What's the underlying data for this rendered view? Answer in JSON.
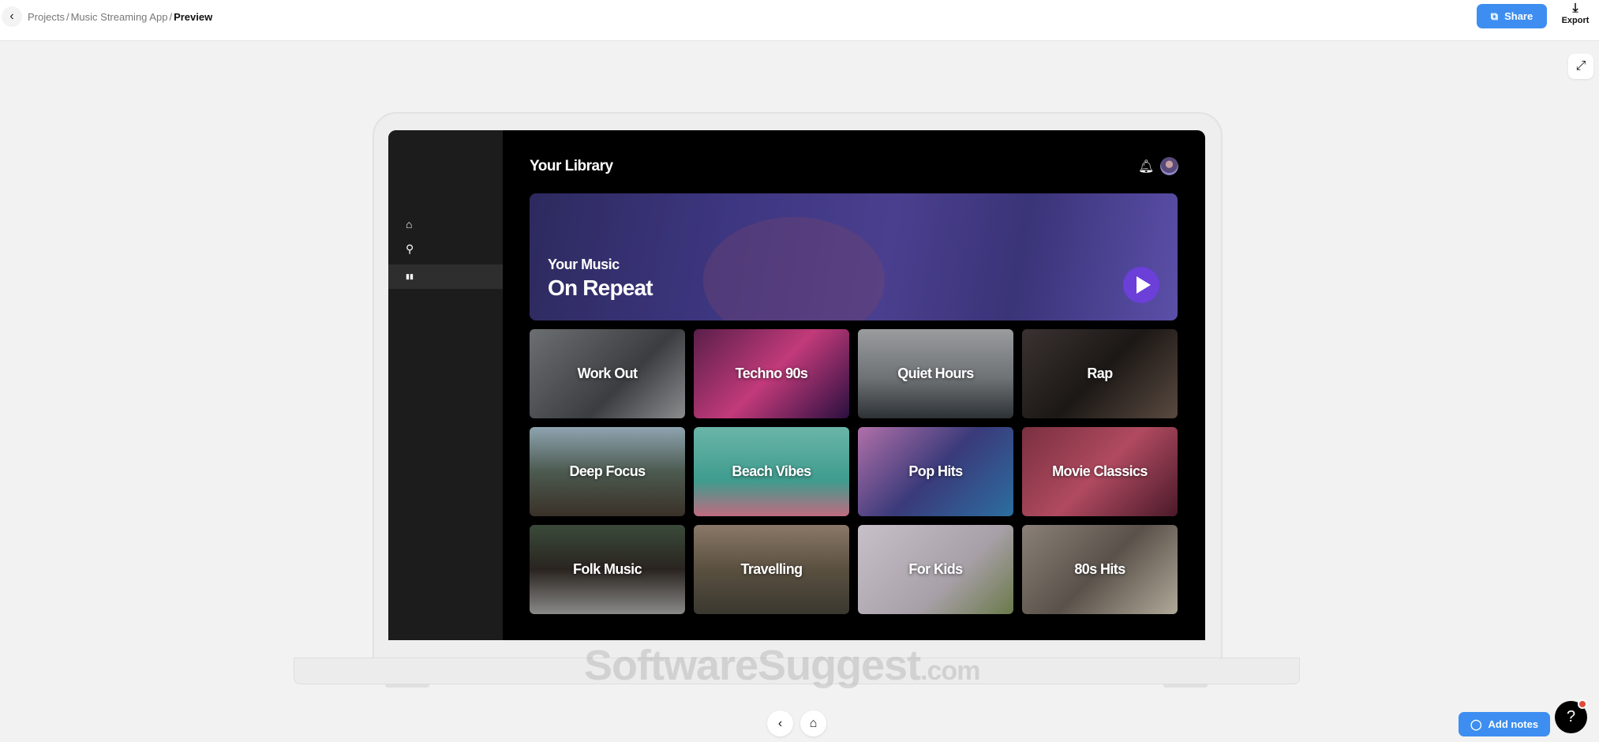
{
  "topbar": {
    "breadcrumb": [
      "Projects",
      "/",
      "Music Streaming App",
      "/",
      "Preview"
    ],
    "share_label": "Share",
    "export_label": "Export",
    "accent": "#3d8ef0"
  },
  "app": {
    "title": "Your Library",
    "sidebar": [
      {
        "icon": "home-icon",
        "glyph": "⌂"
      },
      {
        "icon": "search-icon",
        "glyph": "⚲"
      },
      {
        "icon": "library-icon",
        "glyph": "▮▮",
        "active": true
      }
    ],
    "hero": {
      "subtitle": "Your Music",
      "title": "On Repeat",
      "play_color": "#6b3fd8"
    },
    "tiles": [
      {
        "label": "Work Out",
        "bg": "linear-gradient(135deg,#6c6f72,#3b3d40 60%,#8a8c8e)"
      },
      {
        "label": "Techno 90s",
        "bg": "linear-gradient(135deg,#5a1f4a,#c23a7a 50%,#2a1040)"
      },
      {
        "label": "Quiet Hours",
        "bg": "linear-gradient(180deg,#9a9c9e,#6e7275 55%,#2d3236)"
      },
      {
        "label": "Rap",
        "bg": "linear-gradient(135deg,#3a3230,#1c1816 50%,#5a4a40)"
      },
      {
        "label": "Deep Focus",
        "bg": "linear-gradient(180deg,#8ea4b0,#4c5a50 50%,#3a3128)"
      },
      {
        "label": "Beach Vibes",
        "bg": "linear-gradient(180deg,#6ab5a8,#3e9c8e 60%,#c06b80)"
      },
      {
        "label": "Pop Hits",
        "bg": "linear-gradient(135deg,#b070a8,#3a3a7a 50%,#2c6ea0)"
      },
      {
        "label": "Movie Classics",
        "bg": "linear-gradient(135deg,#7a3040,#b04a60 50%,#4a1a2a)"
      },
      {
        "label": "Folk Music",
        "bg": "linear-gradient(180deg,#3a4a3a,#2a2420 50%,#8a8a88)"
      },
      {
        "label": "Travelling",
        "bg": "linear-gradient(180deg,#8a7868,#5a5040 50%,#3a3830)"
      },
      {
        "label": "For Kids",
        "bg": "linear-gradient(135deg,#c8c0c8,#a8a0a8 60%,#6a7a4a)"
      },
      {
        "label": "80s Hits",
        "bg": "linear-gradient(135deg,#8a8078,#5a524a 50%,#b0a898)"
      }
    ]
  },
  "watermark": {
    "main": "SoftwareSuggest",
    "suffix": ".com"
  },
  "footer": {
    "add_notes_label": "Add notes",
    "help_label": "?"
  }
}
